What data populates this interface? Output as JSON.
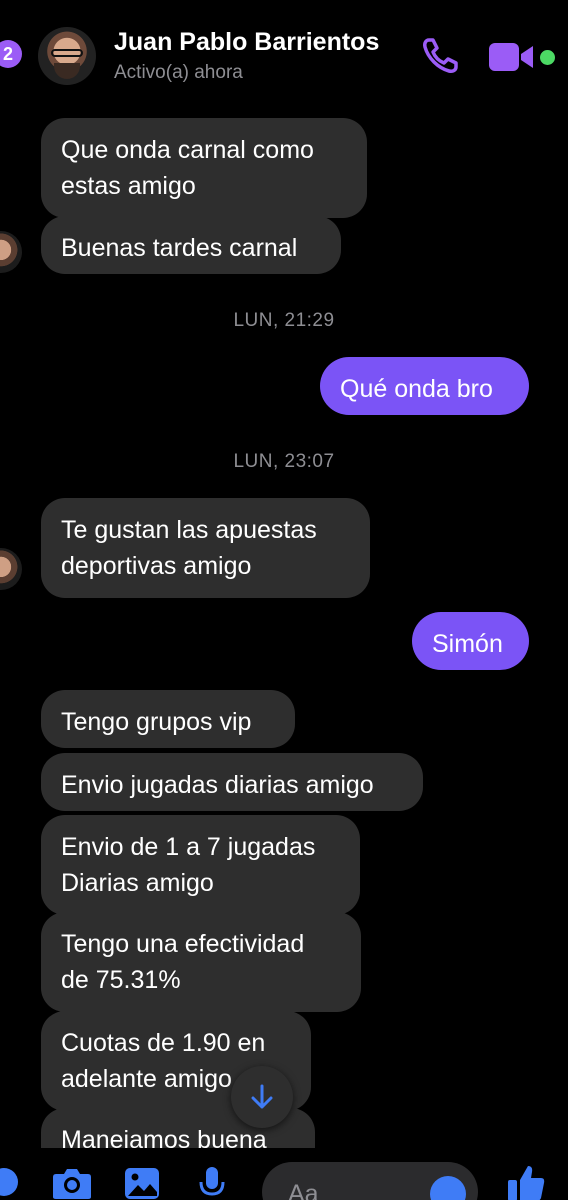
{
  "header": {
    "back_count": "2",
    "contact_name": "Juan Pablo Barrientos",
    "status": "Activo(a) ahora",
    "accent": "#9b5cf6",
    "online_color": "#4cd964"
  },
  "messages": [
    {
      "type": "in",
      "text": "Que onda carnal como\nestas amigo"
    },
    {
      "type": "in",
      "text": "Buenas tardes carnal"
    },
    {
      "type": "timestamp",
      "text": "LUN, 21:29"
    },
    {
      "type": "out",
      "text": "Qué onda bro"
    },
    {
      "type": "timestamp",
      "text": "LUN, 23:07"
    },
    {
      "type": "in",
      "text": "Te gustan las apuestas\ndeportivas amigo"
    },
    {
      "type": "out",
      "text": "Simón"
    },
    {
      "type": "in",
      "text": "Tengo grupos vip"
    },
    {
      "type": "in",
      "text": "Envio jugadas diarias amigo"
    },
    {
      "type": "in",
      "text": "Envio de 1 a 7 jugadas\nDiarias amigo"
    },
    {
      "type": "in",
      "text": "Tengo una efectividad\nde 75.31%"
    },
    {
      "type": "in",
      "text": "Cuotas de 1.90 en\nadelante amigo"
    },
    {
      "type": "in",
      "text": "Manejamos buena"
    }
  ],
  "composer": {
    "placeholder": "Aa",
    "icons": [
      "apps-icon",
      "camera-icon",
      "gallery-icon",
      "mic-icon",
      "emoji-icon",
      "thumbs-up-icon"
    ]
  },
  "colors": {
    "incoming_bubble": "#2e2e2e",
    "outgoing_bubble": "#7b54f6",
    "composer_icon": "#3f7cf6"
  }
}
